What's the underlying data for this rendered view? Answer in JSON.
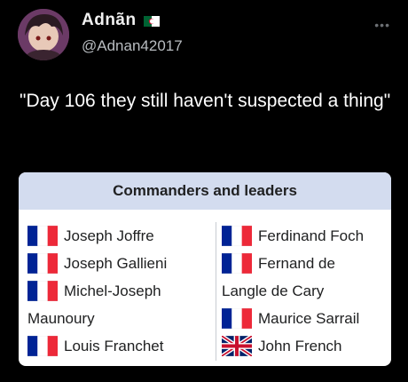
{
  "user": {
    "display_name": "Adnãn",
    "handle": "@Adnan42017",
    "flag_icon": "algeria-flag-icon",
    "avatar_icon": "anime-avatar-icon"
  },
  "more_icon": "more-options-icon",
  "tweet": {
    "text": "\"Day 106 they still haven't suspected a thing\""
  },
  "infobox": {
    "title": "Commanders and leaders",
    "left_column": [
      {
        "flag": "france-flag-icon",
        "lines": [
          "Joseph Joffre"
        ]
      },
      {
        "flag": "france-flag-icon",
        "lines": [
          "Joseph Gallieni"
        ]
      },
      {
        "flag": "france-flag-icon",
        "lines": [
          "Michel-Joseph",
          "Maunoury"
        ]
      },
      {
        "flag": "france-flag-icon",
        "lines": [
          "Louis Franchet"
        ]
      }
    ],
    "right_column": [
      {
        "flag": "france-flag-icon",
        "lines": [
          "Ferdinand Foch"
        ]
      },
      {
        "flag": "france-flag-icon",
        "lines": [
          "Fernand de",
          "Langle de Cary"
        ]
      },
      {
        "flag": "france-flag-icon",
        "lines": [
          "Maurice Sarrail"
        ]
      },
      {
        "flag": "uk-flag-icon",
        "lines": [
          "John French"
        ]
      }
    ]
  },
  "colors": {
    "background": "#000000",
    "header_bg": "#d3dcef",
    "france_blue": "#002395",
    "france_red": "#ed2939"
  }
}
